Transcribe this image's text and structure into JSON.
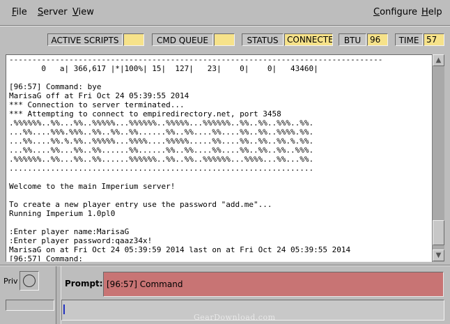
{
  "menubar": {
    "file": {
      "mnemonic": "F",
      "rest": "ile"
    },
    "server": {
      "mnemonic": "S",
      "rest": "erver"
    },
    "view": {
      "mnemonic": "V",
      "rest": "iew"
    },
    "configure": {
      "mnemonic": "C",
      "rest": "onfigure"
    },
    "help": {
      "mnemonic": "H",
      "rest": "elp"
    }
  },
  "status": {
    "active_scripts_label": "ACTIVE SCRIPTS",
    "active_scripts_value": "",
    "cmd_queue_label": "CMD QUEUE",
    "cmd_queue_value": "",
    "status_label": "STATUS",
    "status_value": "CONNECTED",
    "btu_label": "BTU",
    "btu_value": "96",
    "time_label": "TIME",
    "time_value": "57"
  },
  "console": {
    "lines": [
      "---------------------------------------------------------------------------------",
      "       0   a| 366,617 |*|100%| 15|  127|   23|    0|    0|   43460|",
      "",
      "[96:57] Command: bye",
      "MarisaG off at Fri Oct 24 05:39:55 2014",
      "*** Connection to server terminated...",
      "*** Attempting to connect to empiredirectory.net, port 3458",
      ".%%%%%%..%%...%%..%%%%%...%%%%%%..%%%%%...%%%%%%..%%..%%..%%%..%%.",
      "...%%....%%%.%%%..%%..%%..%%......%%..%%....%%....%%..%%..%%%%.%%.",
      "...%%....%%.%.%%..%%%%%...%%%%....%%%%%.....%%....%%..%%..%%.%.%%.",
      "...%%....%%...%%..%%......%%......%%..%%....%%....%%..%%..%%..%%%.",
      ".%%%%%%..%%...%%..%%......%%%%%%..%%..%%..%%%%%%...%%%%...%%...%%.",
      "..................................................................",
      "",
      "Welcome to the main Imperium server!",
      "",
      "To create a new player entry use the password \"add.me\"...",
      "Running Imperium 1.0pl0",
      "",
      ":Enter player name:MarisaG",
      ":Enter player password:qaaz34x!",
      "MarisaG on at Fri Oct 24 05:39:59 2014 last on at Fri Oct 24 05:39:55 2014",
      "[96:57] Command:"
    ]
  },
  "bottom": {
    "priv_label": "Priv",
    "prompt_label": "Prompt:",
    "prompt_value": "[96:57] Command",
    "input_value": ""
  },
  "watermark": "GearDownload.com",
  "colors": {
    "background": "#bdbdbd",
    "status_value_bg": "#f6e28a",
    "prompt_bg": "#c87474",
    "console_bg": "#ffffff"
  }
}
